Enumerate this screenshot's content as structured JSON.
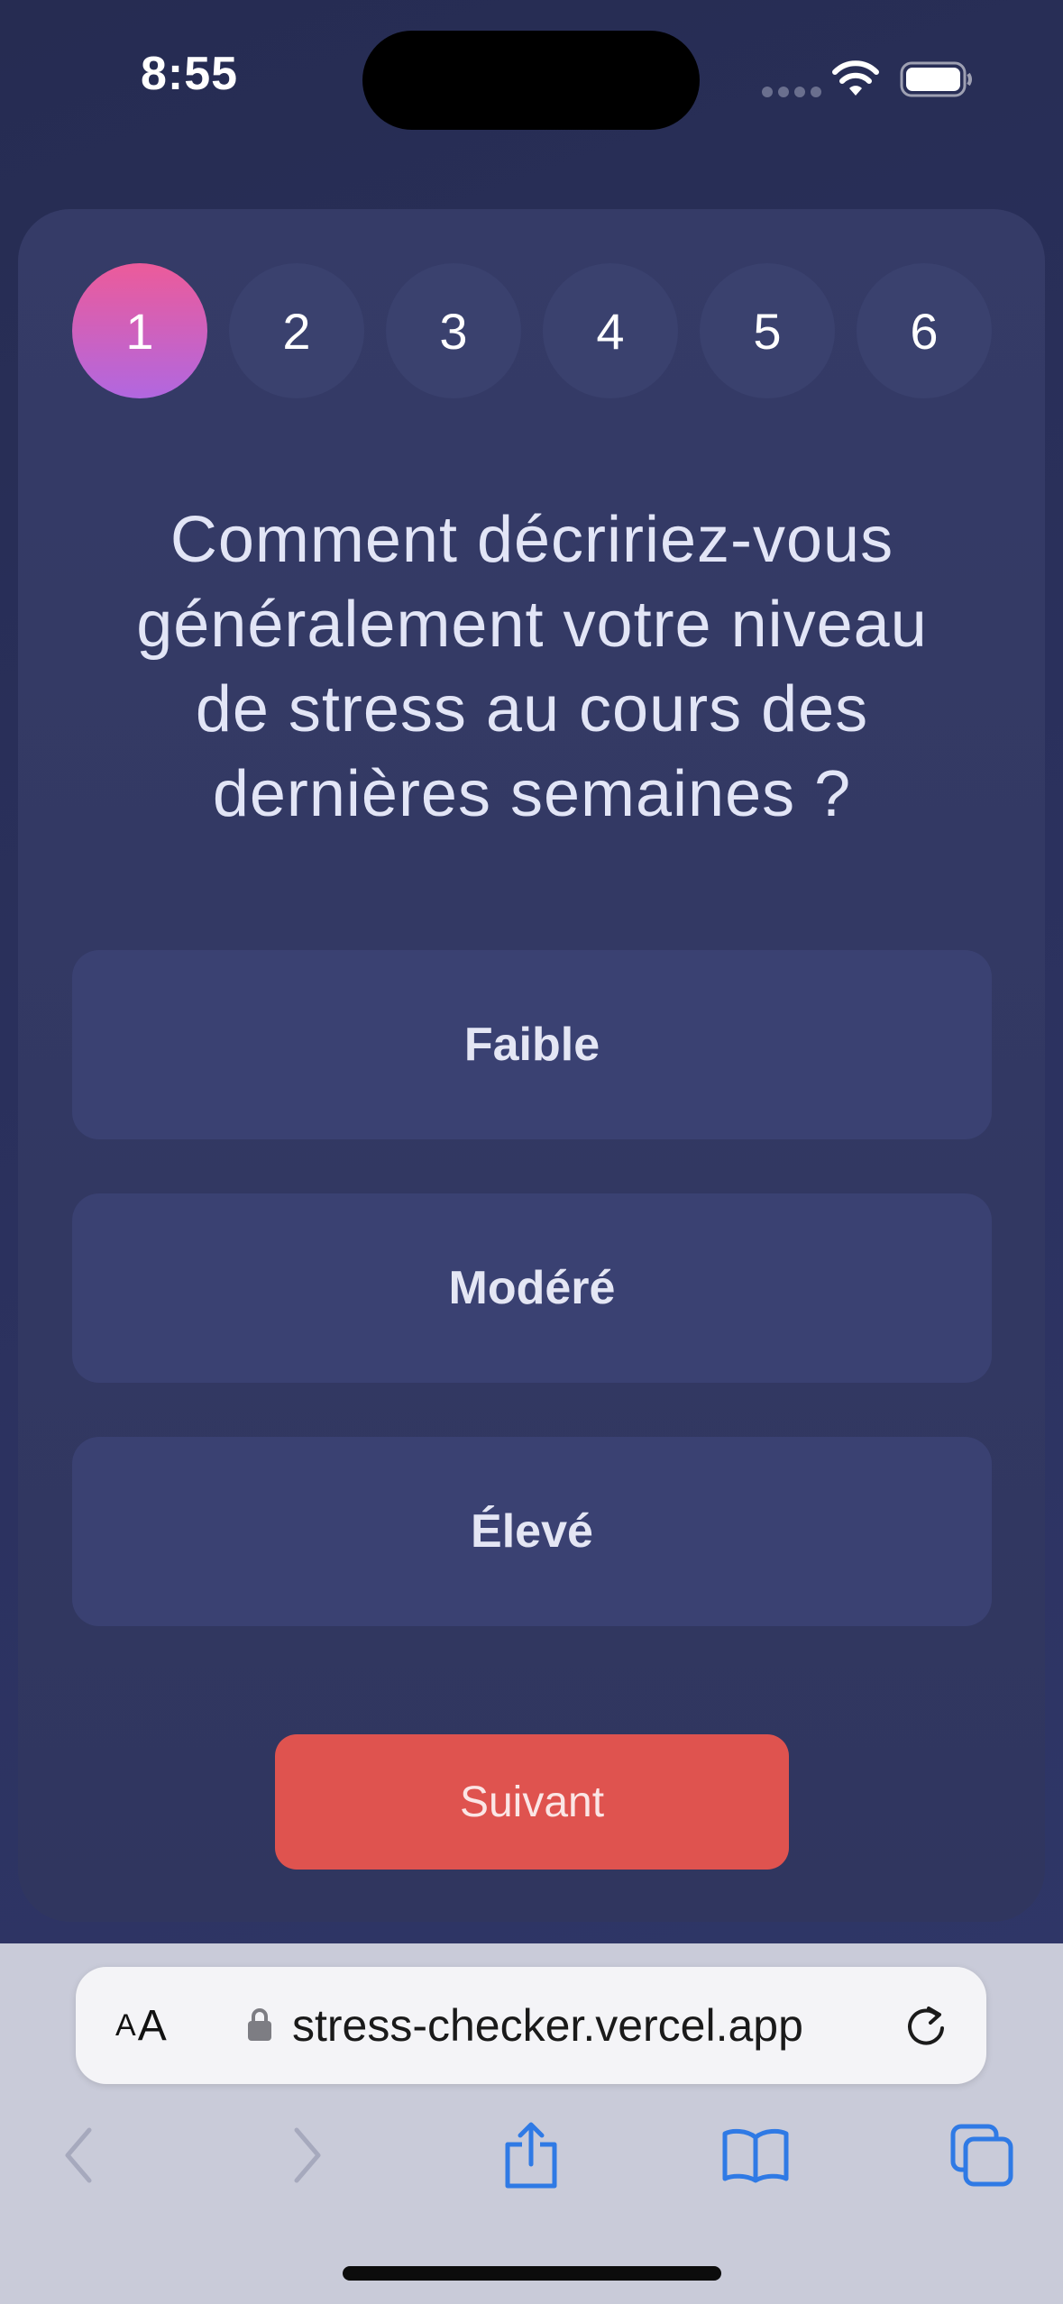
{
  "status_bar": {
    "time": "8:55"
  },
  "steps": [
    "1",
    "2",
    "3",
    "4",
    "5",
    "6"
  ],
  "active_step": "1",
  "question": "Comment décririez-vous généralement votre niveau de stress au cours des dernières semaines ?",
  "answers": [
    "Faible",
    "Modéré",
    "Élevé"
  ],
  "next_label": "Suivant",
  "browser": {
    "text_size_small": "A",
    "text_size_large": "A",
    "url": "stress-checker.vercel.app"
  },
  "colors": {
    "background": "#2a305a",
    "card": "#353b67",
    "active_step_gradient_start": "#ec5b9a",
    "active_step_gradient_end": "#b167e0",
    "answer_bg": "#3a4172",
    "next_button": "#df534f",
    "toolbar_icon_active": "#2f7ae5",
    "toolbar_icon_disabled": "#a6a9bd"
  },
  "icons": {
    "wifi": "wifi-icon",
    "battery": "battery-icon",
    "lock": "lock-icon",
    "reload": "reload-icon",
    "back": "back-chevron-icon",
    "forward": "forward-chevron-icon",
    "share": "share-icon",
    "bookmarks": "book-icon",
    "tabs": "tabs-icon"
  }
}
